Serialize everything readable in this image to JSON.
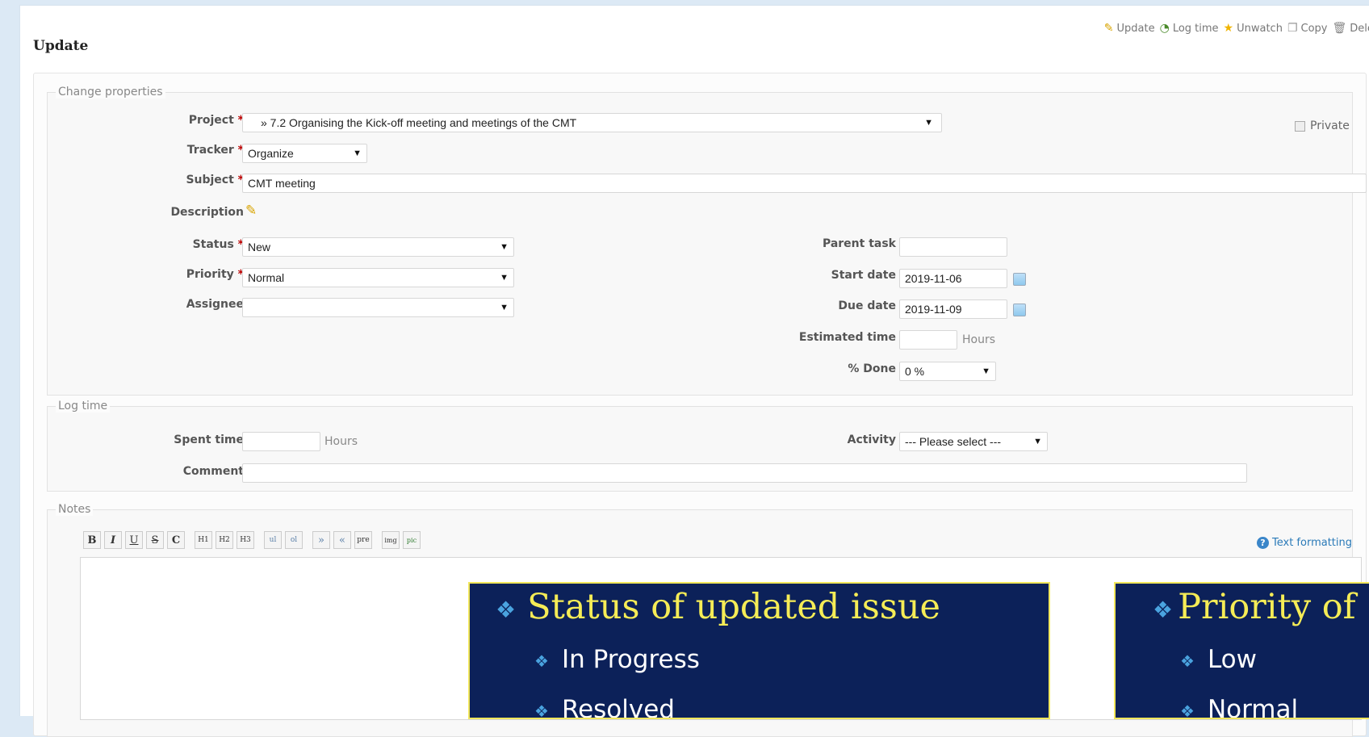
{
  "title": "Update",
  "actions": [
    {
      "icon": "pencil-icon",
      "label": "Update"
    },
    {
      "icon": "clock-icon",
      "label": "Log time"
    },
    {
      "icon": "star-icon",
      "label": "Unwatch"
    },
    {
      "icon": "copy-icon",
      "label": "Copy"
    },
    {
      "icon": "trash-icon",
      "label": "Delete"
    }
  ],
  "properties": {
    "legend": "Change properties",
    "project": {
      "label": "Project",
      "value": "» 7.2 Organising the Kick-off meeting and meetings of the CMT"
    },
    "private_label": "Private",
    "tracker": {
      "label": "Tracker",
      "value": "Organize"
    },
    "subject": {
      "label": "Subject",
      "value": "CMT meeting"
    },
    "description": {
      "label": "Description"
    },
    "status": {
      "label": "Status",
      "value": "New"
    },
    "priority": {
      "label": "Priority",
      "value": "Normal"
    },
    "assignee": {
      "label": "Assignee",
      "value": ""
    },
    "parent_task": {
      "label": "Parent task",
      "value": ""
    },
    "start_date": {
      "label": "Start date",
      "value": "2019-11-06"
    },
    "due_date": {
      "label": "Due date",
      "value": "2019-11-09"
    },
    "estimated_time": {
      "label": "Estimated time",
      "value": "",
      "unit": "Hours"
    },
    "done": {
      "label": "% Done",
      "value": "0 %"
    }
  },
  "log_time": {
    "legend": "Log time",
    "spent_time": {
      "label": "Spent time",
      "value": "",
      "unit": "Hours"
    },
    "activity": {
      "label": "Activity",
      "value": "--- Please select ---"
    },
    "comment": {
      "label": "Comment",
      "value": ""
    }
  },
  "notes": {
    "legend": "Notes",
    "toolbar": [
      "B",
      "I",
      "U",
      "S",
      "C",
      "H1",
      "H2",
      "H3",
      "ul",
      "ol",
      "»",
      "«",
      "pre",
      "img",
      "pic"
    ],
    "text_formatting": "Text formatting"
  },
  "overlay_status": {
    "title": "Status of updated issue",
    "items": [
      "In Progress",
      "Resolved"
    ]
  },
  "overlay_priority": {
    "title": "Priority of",
    "items": [
      "Low",
      "Normal"
    ]
  },
  "colors": {
    "slide_bg": "#0c2159",
    "slide_title": "#f5ec56",
    "slide_border": "#f2e75b",
    "required": "#bb0000"
  }
}
